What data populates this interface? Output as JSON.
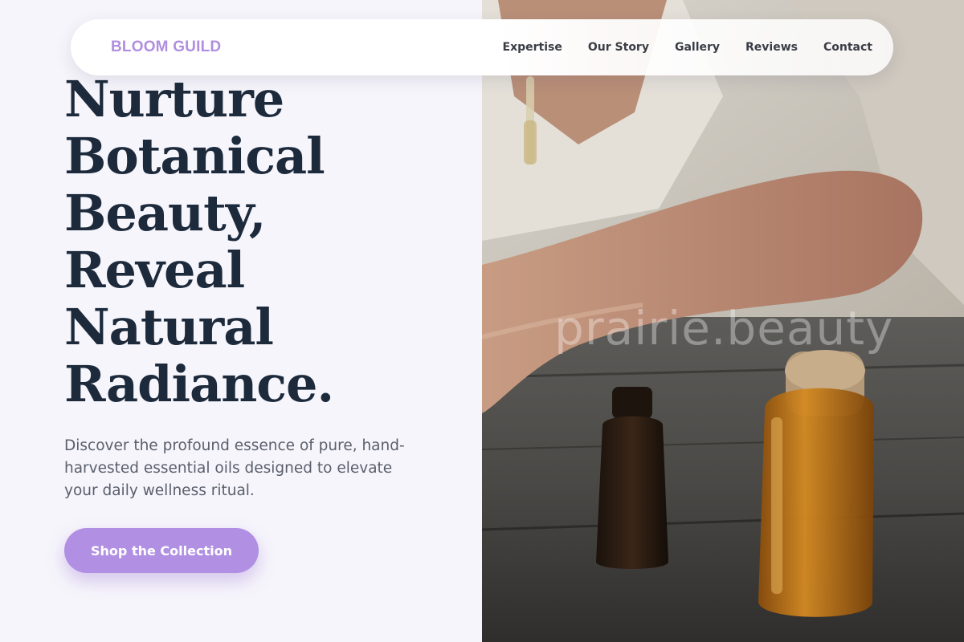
{
  "brand": {
    "name": "BLOOM GUILD"
  },
  "nav": {
    "items": [
      {
        "label": "Expertise"
      },
      {
        "label": "Our Story"
      },
      {
        "label": "Gallery"
      },
      {
        "label": "Reviews"
      },
      {
        "label": "Contact"
      }
    ]
  },
  "hero": {
    "headline_lines": [
      "Nurture",
      "Botanical",
      "Beauty,",
      "Reveal",
      "Natural",
      "Radiance."
    ],
    "subtext": "Discover the profound essence of pure, hand-harvested essential oils designed to elevate your daily wellness ritual.",
    "cta_label": "Shop the Collection"
  },
  "image": {
    "watermark": "prairie.beauty"
  },
  "colors": {
    "accent": "#b190e4",
    "heading": "#1c2a3c",
    "body_text": "#5a5f6b",
    "background": "#f6f5fb"
  }
}
